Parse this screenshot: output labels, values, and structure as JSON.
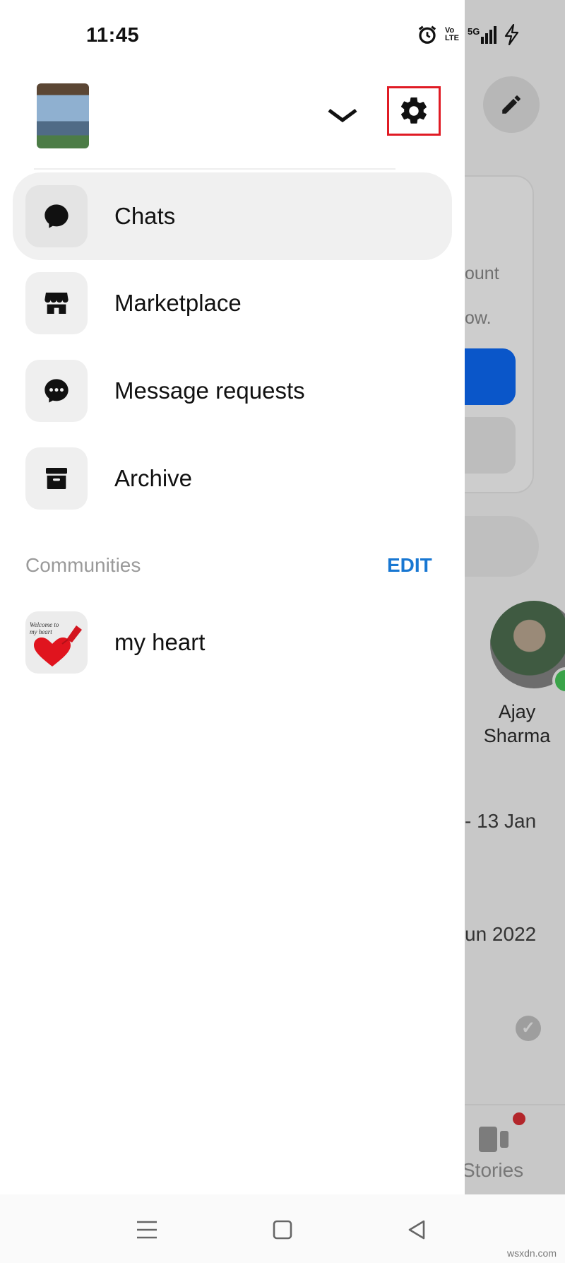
{
  "status_bar": {
    "time": "11:45",
    "icons": [
      "alarm-icon",
      "volte-icon",
      "5g-signal-icon",
      "charging-icon"
    ],
    "volte_text": "Vo LTE",
    "network_text": "5G"
  },
  "drawer": {
    "menu": [
      {
        "label": "Chats",
        "icon": "chat-bubble-icon",
        "active": true
      },
      {
        "label": "Marketplace",
        "icon": "storefront-icon",
        "active": false
      },
      {
        "label": "Message requests",
        "icon": "message-requests-icon",
        "active": false
      },
      {
        "label": "Archive",
        "icon": "archive-box-icon",
        "active": false
      }
    ],
    "communities": {
      "title": "Communities",
      "edit_label": "EDIT",
      "items": [
        {
          "label": "my heart",
          "thumb_text": "Welcome to my heart"
        }
      ]
    }
  },
  "background": {
    "text_fragments": [
      "ount",
      "ow."
    ],
    "contact_name": "Ajay Sharma",
    "dates": [
      "- 13 Jan",
      "un 2022"
    ],
    "stories_label": "Stories"
  },
  "watermark": "wsxdn.com",
  "colors": {
    "accent_blue": "#1877d2",
    "highlight_red": "#e01b24",
    "active_item_bg": "#f0f0f0",
    "scrim": "#c8c8c8"
  }
}
